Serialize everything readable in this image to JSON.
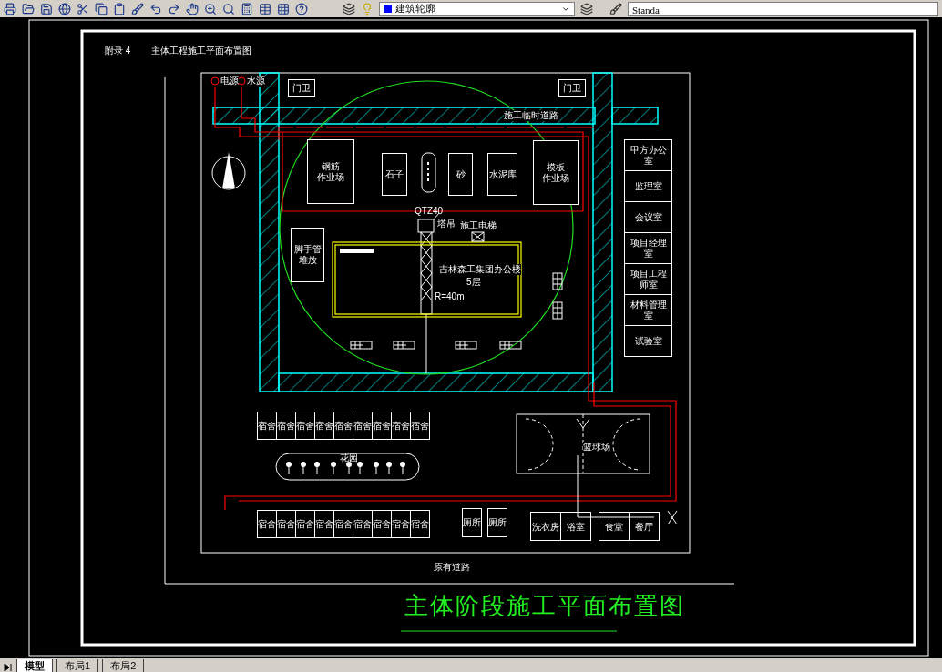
{
  "toolbar": {
    "layer": "建筑轮廓",
    "text_style": "Standa"
  },
  "drawing": {
    "appendix_number": "附录 4",
    "appendix_title": "主体工程施工平面布置图",
    "source_labels": [
      "电源",
      "水源"
    ],
    "gates": [
      "门卫",
      "门卫"
    ],
    "road_label": "施工临时道路",
    "yards": [
      {
        "lines": [
          "钢筋",
          "作业场"
        ]
      },
      {
        "lines": [
          "石子"
        ]
      },
      {
        "lines": [
          "砂"
        ]
      },
      {
        "lines": [
          "水泥库"
        ]
      },
      {
        "lines": [
          "模板",
          "作业场"
        ]
      },
      {
        "lines": [
          "脚手管",
          "堆放"
        ]
      }
    ],
    "crane": {
      "model": "QTZ40",
      "label": "塔吊",
      "radius": "R=40m"
    },
    "hoist_label": "施工电梯",
    "building": {
      "name": "吉林森工集团办公楼",
      "floors": "5层"
    },
    "offices": [
      "甲方办公室",
      "监理室",
      "会议室",
      "项目经理室",
      "项目工程师室",
      "材料管理室",
      "试验室"
    ],
    "dorms_top": [
      "宿舍",
      "宿舍",
      "宿舍",
      "宿舍",
      "宿舍",
      "宿舍",
      "宿舍",
      "宿舍",
      "宿舍"
    ],
    "garden": "花园",
    "court": "篮球场",
    "dorms_bottom": [
      "宿舍",
      "宿舍",
      "宿舍",
      "宿舍",
      "宿舍",
      "宿舍",
      "宿舍",
      "宿舍",
      "宿舍"
    ],
    "toilets": [
      "厕所",
      "厕所"
    ],
    "service_rooms": [
      "洗衣房",
      "浴室",
      "食堂",
      "餐厅"
    ],
    "existing_road": "原有道路",
    "plan_title": "主体阶段施工平面布置图"
  },
  "layout_tabs": [
    {
      "label": "模型",
      "selected": true
    },
    {
      "label": "布局1",
      "selected": false
    },
    {
      "label": "布局2",
      "selected": false
    }
  ]
}
